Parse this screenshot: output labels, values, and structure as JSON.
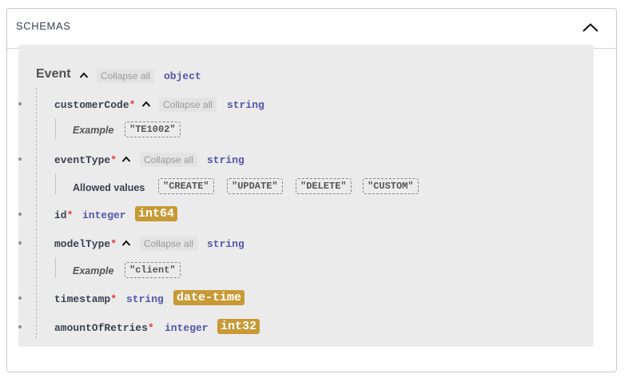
{
  "section": {
    "title": "SCHEMAS"
  },
  "model": {
    "name": "Event",
    "collapse_label": "Collapse all",
    "type": "object",
    "properties": [
      {
        "name": "customerCode",
        "required_mark": "*",
        "collapse_label": "Collapse all",
        "type": "string",
        "example_label": "Example",
        "example_value": "\"TE1002\""
      },
      {
        "name": "eventType",
        "required_mark": "*",
        "collapse_label": "Collapse all",
        "type": "string",
        "allowed_label": "Allowed values",
        "allowed_values": [
          "\"CREATE\"",
          "\"UPDATE\"",
          "\"DELETE\"",
          "\"CUSTOM\""
        ]
      },
      {
        "name": "id",
        "required_mark": "*",
        "type": "integer",
        "format": "int64"
      },
      {
        "name": "modelType",
        "required_mark": "*",
        "collapse_label": "Collapse all",
        "type": "string",
        "example_label": "Example",
        "example_value": "\"client\""
      },
      {
        "name": "timestamp",
        "required_mark": "*",
        "type": "string",
        "format": "date-time"
      },
      {
        "name": "amountOfRetries",
        "required_mark": "*",
        "type": "integer",
        "format": "int32"
      }
    ]
  },
  "icons": {
    "panel_toggle": "chevron-up-icon",
    "model_caret": "caret-up-icon",
    "bullet": "bullet-dot-icon"
  },
  "colors": {
    "format_badge": "#c79a36",
    "type_text": "#5555aa",
    "required_mark": "#e93b3b",
    "model_background": "#ebebeb"
  }
}
